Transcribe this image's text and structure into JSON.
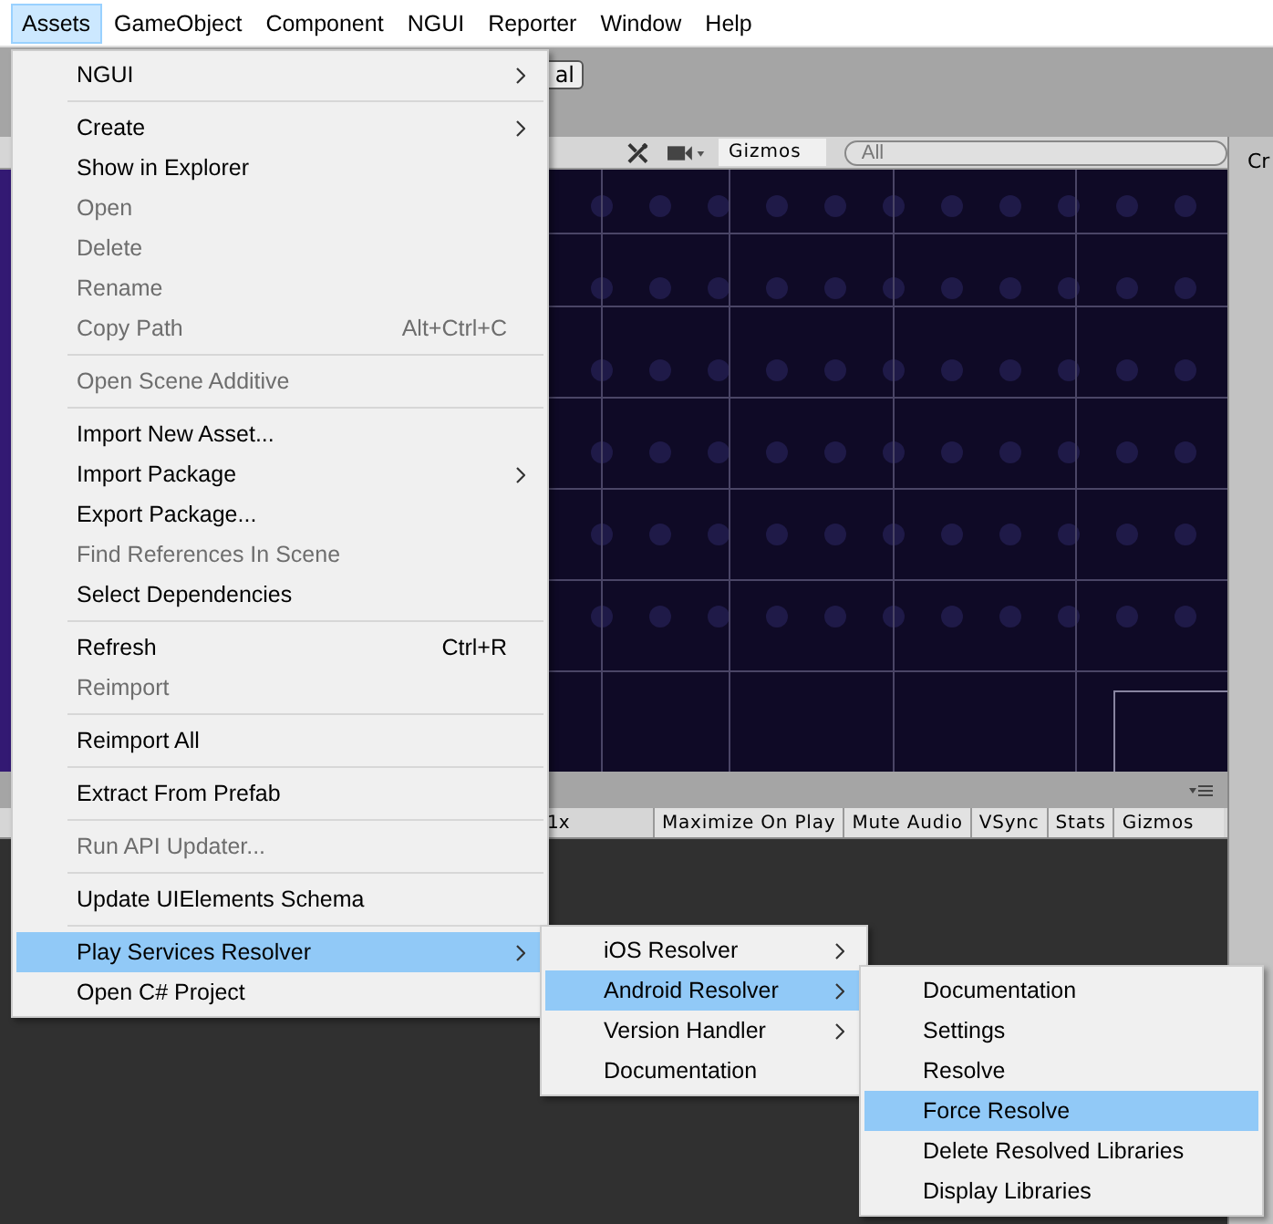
{
  "menubar": [
    {
      "label": "Assets",
      "selected": true
    },
    {
      "label": "GameObject",
      "selected": false
    },
    {
      "label": "Component",
      "selected": false
    },
    {
      "label": "NGUI",
      "selected": false
    },
    {
      "label": "Reporter",
      "selected": false
    },
    {
      "label": "Window",
      "selected": false
    },
    {
      "label": "Help",
      "selected": false
    }
  ],
  "toolbar": {
    "button": "al"
  },
  "scene_view": {
    "gizmos": "Gizmos",
    "search": {
      "placeholder": "All"
    }
  },
  "inspector_tab": "Cr",
  "game_view": {
    "scale": "1x",
    "buttons": [
      "Maximize On Play",
      "Mute Audio",
      "VSync",
      "Stats",
      "Gizmos"
    ]
  },
  "assets_menu": {
    "items": [
      {
        "kind": "item",
        "label": "NGUI",
        "submenu": true,
        "disabled": false,
        "selected": false
      },
      {
        "kind": "separator"
      },
      {
        "kind": "item",
        "label": "Create",
        "submenu": true,
        "disabled": false,
        "selected": false
      },
      {
        "kind": "item",
        "label": "Show in Explorer",
        "submenu": false,
        "disabled": false,
        "selected": false
      },
      {
        "kind": "item",
        "label": "Open",
        "submenu": false,
        "disabled": true,
        "selected": false
      },
      {
        "kind": "item",
        "label": "Delete",
        "submenu": false,
        "disabled": true,
        "selected": false
      },
      {
        "kind": "item",
        "label": "Rename",
        "submenu": false,
        "disabled": true,
        "selected": false
      },
      {
        "kind": "item",
        "label": "Copy Path",
        "shortcut": "Alt+Ctrl+C",
        "submenu": false,
        "disabled": true,
        "selected": false
      },
      {
        "kind": "separator"
      },
      {
        "kind": "item",
        "label": "Open Scene Additive",
        "submenu": false,
        "disabled": true,
        "selected": false
      },
      {
        "kind": "separator"
      },
      {
        "kind": "item",
        "label": "Import New Asset...",
        "submenu": false,
        "disabled": false,
        "selected": false
      },
      {
        "kind": "item",
        "label": "Import Package",
        "submenu": true,
        "disabled": false,
        "selected": false
      },
      {
        "kind": "item",
        "label": "Export Package...",
        "submenu": false,
        "disabled": false,
        "selected": false
      },
      {
        "kind": "item",
        "label": "Find References In Scene",
        "submenu": false,
        "disabled": true,
        "selected": false
      },
      {
        "kind": "item",
        "label": "Select Dependencies",
        "submenu": false,
        "disabled": false,
        "selected": false
      },
      {
        "kind": "separator"
      },
      {
        "kind": "item",
        "label": "Refresh",
        "shortcut": "Ctrl+R",
        "submenu": false,
        "disabled": false,
        "selected": false
      },
      {
        "kind": "item",
        "label": "Reimport",
        "submenu": false,
        "disabled": true,
        "selected": false
      },
      {
        "kind": "separator"
      },
      {
        "kind": "item",
        "label": "Reimport All",
        "submenu": false,
        "disabled": false,
        "selected": false
      },
      {
        "kind": "separator"
      },
      {
        "kind": "item",
        "label": "Extract From Prefab",
        "submenu": false,
        "disabled": false,
        "selected": false
      },
      {
        "kind": "separator"
      },
      {
        "kind": "item",
        "label": "Run API Updater...",
        "submenu": false,
        "disabled": true,
        "selected": false
      },
      {
        "kind": "separator"
      },
      {
        "kind": "item",
        "label": "Update UIElements Schema",
        "submenu": false,
        "disabled": false,
        "selected": false
      },
      {
        "kind": "separator"
      },
      {
        "kind": "item",
        "label": "Play Services Resolver",
        "submenu": true,
        "disabled": false,
        "selected": true
      },
      {
        "kind": "item",
        "label": "Open C# Project",
        "submenu": false,
        "disabled": false,
        "selected": false
      }
    ]
  },
  "play_services_menu": {
    "items": [
      {
        "kind": "item",
        "label": "iOS Resolver",
        "submenu": true,
        "disabled": false,
        "selected": false
      },
      {
        "kind": "item",
        "label": "Android Resolver",
        "submenu": true,
        "disabled": false,
        "selected": true
      },
      {
        "kind": "item",
        "label": "Version Handler",
        "submenu": true,
        "disabled": false,
        "selected": false
      },
      {
        "kind": "item",
        "label": "Documentation",
        "submenu": false,
        "disabled": false,
        "selected": false
      }
    ]
  },
  "android_resolver_menu": {
    "items": [
      {
        "kind": "item",
        "label": "Documentation",
        "submenu": false,
        "disabled": false,
        "selected": false
      },
      {
        "kind": "item",
        "label": "Settings",
        "submenu": false,
        "disabled": false,
        "selected": false
      },
      {
        "kind": "item",
        "label": "Resolve",
        "submenu": false,
        "disabled": false,
        "selected": false
      },
      {
        "kind": "item",
        "label": "Force Resolve",
        "submenu": false,
        "disabled": false,
        "selected": true
      },
      {
        "kind": "item",
        "label": "Delete Resolved Libraries",
        "submenu": false,
        "disabled": false,
        "selected": false
      },
      {
        "kind": "item",
        "label": "Display Libraries",
        "submenu": false,
        "disabled": false,
        "selected": false
      }
    ]
  }
}
